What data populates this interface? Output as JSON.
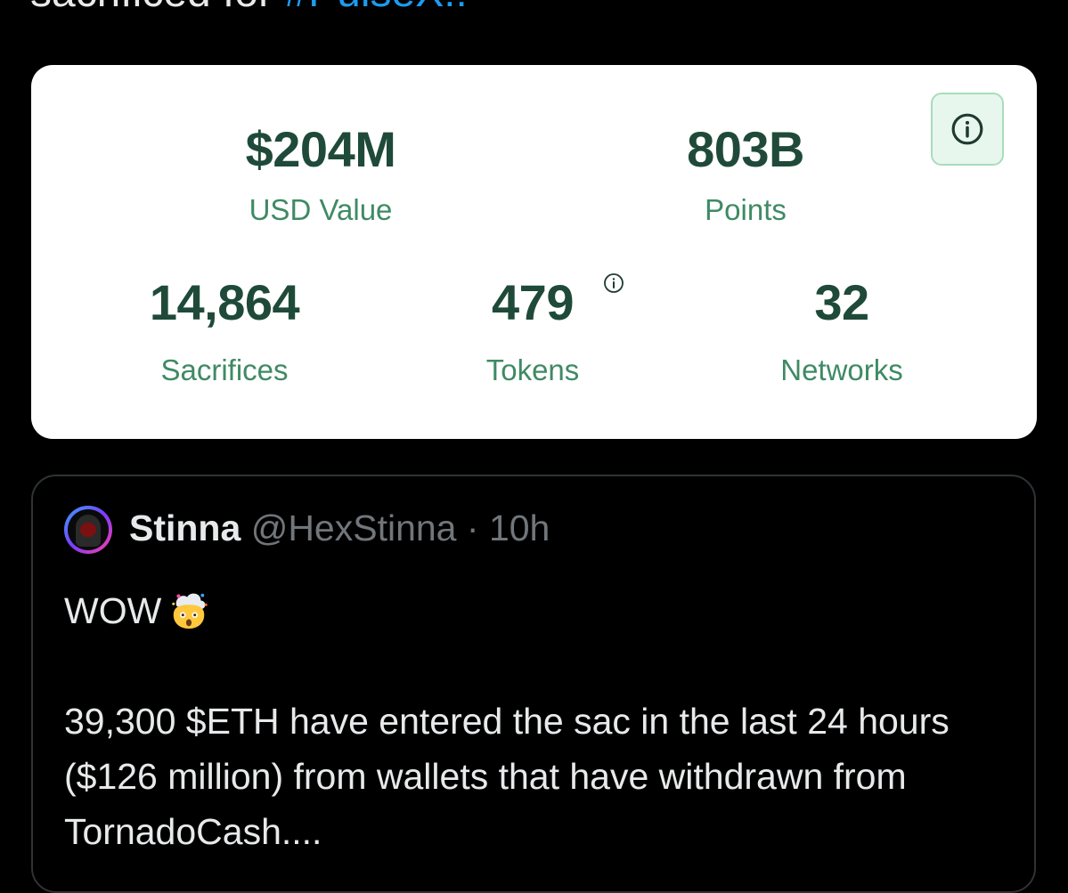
{
  "header": {
    "partial_text": "sacrificed for ",
    "partial_hashtag": "#PulseX!!"
  },
  "stats": {
    "usd_value": {
      "value": "$204M",
      "label": "USD Value"
    },
    "points": {
      "value": "803B",
      "label": "Points"
    },
    "sacrifices": {
      "value": "14,864",
      "label": "Sacrifices"
    },
    "tokens": {
      "value": "479",
      "label": "Tokens"
    },
    "networks": {
      "value": "32",
      "label": "Networks"
    }
  },
  "quote": {
    "author_name": "Stinna",
    "author_handle": "@HexStinna",
    "separator": " · ",
    "time": "10h",
    "line1": "WOW",
    "body": "39,300 $ETH have entered the sac in the last 24 hours ($126 million) from wallets that have withdrawn from TornadoCash...."
  },
  "icons": {
    "info": "info-circle-icon",
    "emoji": "exploding-head-emoji",
    "avatar": "hooded-figure-avatar"
  },
  "colors": {
    "value_text": "#1f4a3a",
    "label_text": "#3f8a64",
    "info_button_bg": "#e8f7ee",
    "hashtag": "#1d9bf0"
  }
}
